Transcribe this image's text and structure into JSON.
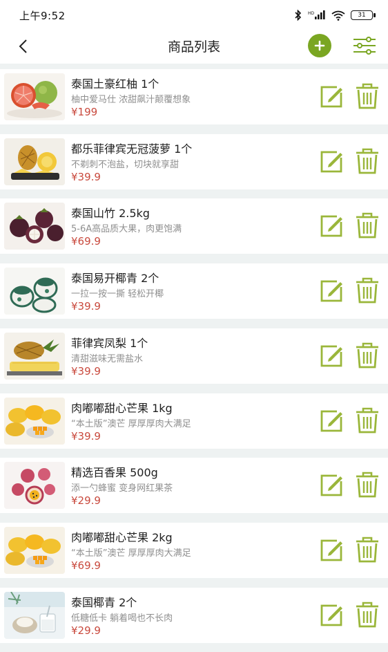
{
  "status": {
    "time": "上午9:52",
    "battery": "31"
  },
  "header": {
    "title": "商品列表"
  },
  "colors": {
    "accent": "#7aa622",
    "price": "#c94a3e"
  },
  "products": [
    {
      "name": "泰国土豪红柚 1个",
      "desc": "柚中爱马仕 浓甜飙汁颠覆想象",
      "price": "¥199",
      "thumb": "pomelo"
    },
    {
      "name": "都乐菲律宾无冠菠萝 1个",
      "desc": "不剃刺不泡盐，切块就享甜",
      "price": "¥39.9",
      "thumb": "pineapple"
    },
    {
      "name": "泰国山竹 2.5kg",
      "desc": "5-6A高品质大果，肉更饱满",
      "price": "¥69.9",
      "thumb": "mangosteen"
    },
    {
      "name": "泰国易开椰青 2个",
      "desc": "一拉一按一撕 轻松开椰",
      "price": "¥39.9",
      "thumb": "coconut"
    },
    {
      "name": "菲律宾凤梨 1个",
      "desc": "清甜滋味无需盐水",
      "price": "¥39.9",
      "thumb": "pineapple2"
    },
    {
      "name": "肉嘟嘟甜心芒果 1kg",
      "desc": "“本土版”澳芒 厚厚厚肉大满足",
      "price": "¥39.9",
      "thumb": "mango"
    },
    {
      "name": "精选百香果 500g",
      "desc": "添一勺蜂蜜 变身网红果茶",
      "price": "¥29.9",
      "thumb": "passionfruit"
    },
    {
      "name": "肉嘟嘟甜心芒果 2kg",
      "desc": "“本土版”澳芒 厚厚厚肉大满足",
      "price": "¥69.9",
      "thumb": "mango"
    },
    {
      "name": "泰国椰青 2个",
      "desc": "低糖低卡 躺着喝也不长肉",
      "price": "¥29.9",
      "thumb": "coconut2"
    }
  ]
}
